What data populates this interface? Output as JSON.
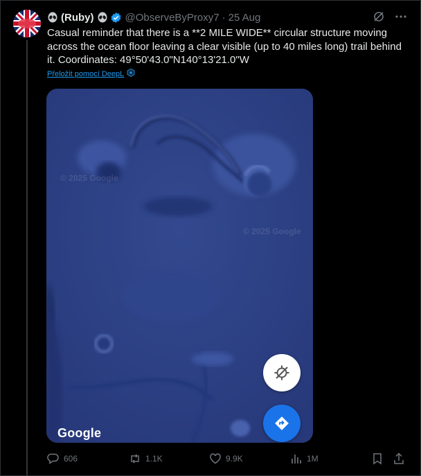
{
  "author": {
    "display_name": "(Ruby)",
    "handle": "@ObserveByProxy7",
    "date_sep": "·",
    "date": "25 Aug"
  },
  "tweet": {
    "text": "Casual reminder that there is a **2 MILE WIDE** circular structure moving across the ocean floor leaving a clear visible (up to 40 miles long) trail behind it. Coordinates: 49°50'43.0\"N140°13'21.0\"W",
    "translate_label": "Přeložit pomocí DeepL"
  },
  "map": {
    "watermark_1": "© 2025 Google",
    "watermark_2": "© 2025 Google",
    "logo": "Google"
  },
  "actions": {
    "replies": "606",
    "reposts": "1.1K",
    "likes": "9.9K",
    "views": "1M"
  },
  "icons": {
    "alien": "alien-emoji-icon",
    "verified": "verified-badge-icon",
    "grok": "grok-icon",
    "more": "more-icon",
    "locate": "locate-icon",
    "directions": "directions-icon",
    "reply": "reply-icon",
    "repost": "repost-icon",
    "like": "like-icon",
    "views": "views-icon",
    "bookmark": "bookmark-icon",
    "share": "share-icon"
  },
  "colors": {
    "accent": "#1d9bf0",
    "map_ocean": "#2e448d",
    "directions_button": "#1a73e8"
  }
}
